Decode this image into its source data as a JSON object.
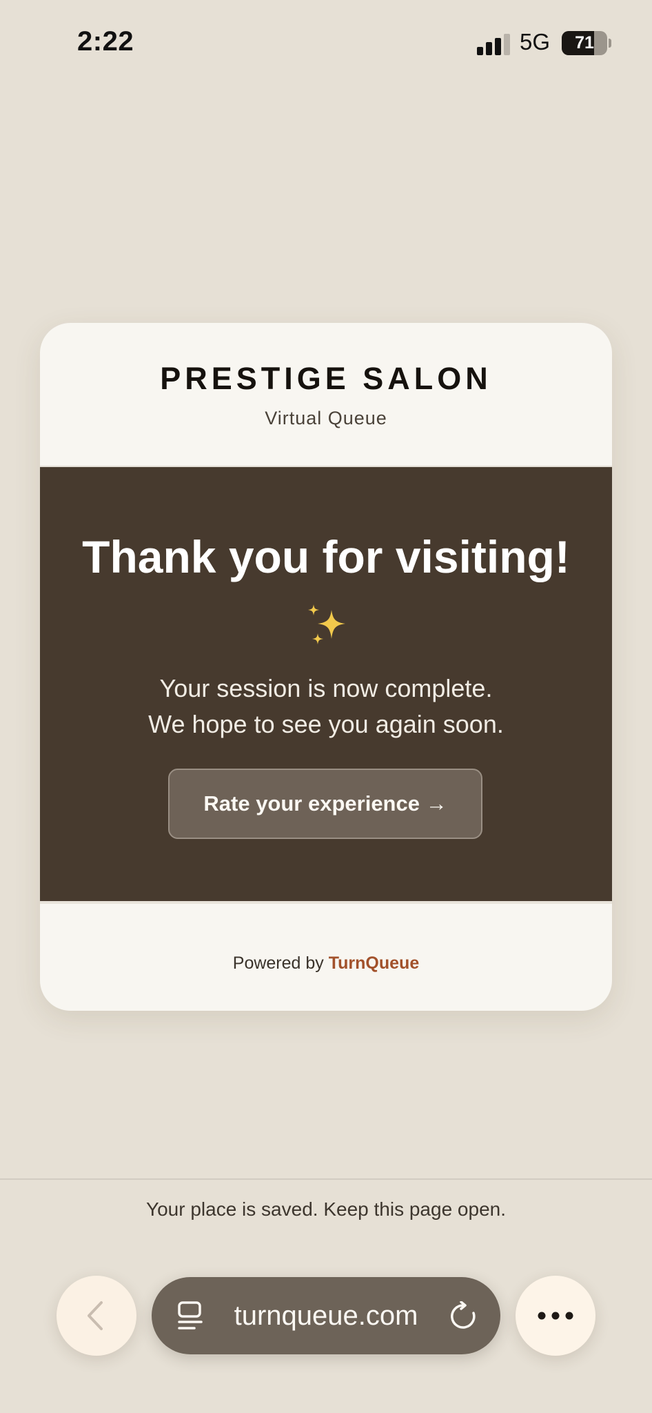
{
  "status_bar": {
    "time": "2:22",
    "network": "5G",
    "battery_level": 71,
    "battery_label": "71",
    "signal_bars_active": 3
  },
  "card": {
    "salon_name": "PRESTIGE SALON",
    "subtitle": "Virtual Queue",
    "heading": "Thank you for visiting!",
    "sparkle_icon": "sparkles-icon",
    "message_line1": "Your session is now complete.",
    "message_line2": "We hope to see you again soon.",
    "rate_button_label": "Rate your experience →",
    "powered_prefix": "Powered by ",
    "powered_brand": "TurnQueue"
  },
  "bottom": {
    "saved_note": "Your place is saved. Keep this page open.",
    "url": "turnqueue.com"
  },
  "colors": {
    "background": "#e6e0d5",
    "card": "#f8f6f1",
    "panel": "#473a2e",
    "brand_accent": "#a2512b",
    "sparkle": "#f2c94c"
  }
}
